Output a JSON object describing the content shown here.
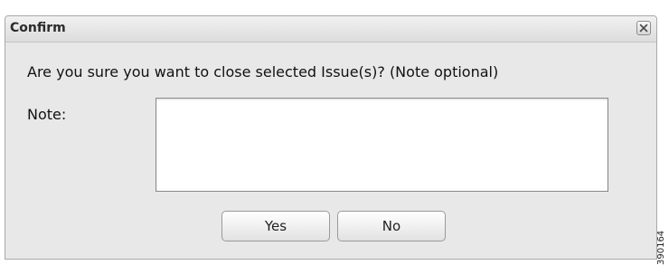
{
  "dialog": {
    "title": "Confirm",
    "message": "Are you sure you want to close selected Issue(s)? (Note optional)",
    "note_label": "Note:",
    "note_value": "",
    "yes_label": "Yes",
    "no_label": "No"
  },
  "icons": {
    "close": "close-icon"
  },
  "figure_id": "390164"
}
